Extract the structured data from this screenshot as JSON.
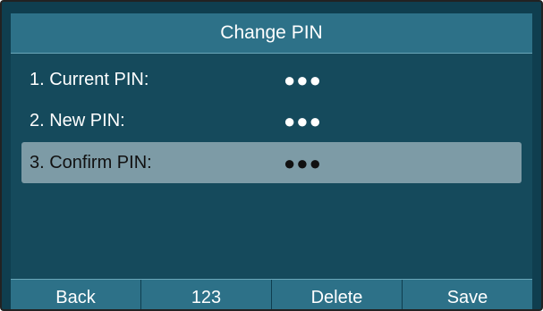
{
  "header": {
    "title": "Change PIN"
  },
  "fields": [
    {
      "label": "1. Current PIN:",
      "value": "●●●"
    },
    {
      "label": "2. New PIN:",
      "value": "●●●"
    },
    {
      "label": "3. Confirm PIN:",
      "value": "●●●",
      "selected": true
    }
  ],
  "softkeys": {
    "back": "Back",
    "input_mode": "123",
    "delete": "Delete",
    "save": "Save"
  },
  "colors": {
    "background": "#0f3e4f",
    "title_bar": "#2d7188",
    "selected_row": "#7d9ba6",
    "text": "#ffffff"
  }
}
